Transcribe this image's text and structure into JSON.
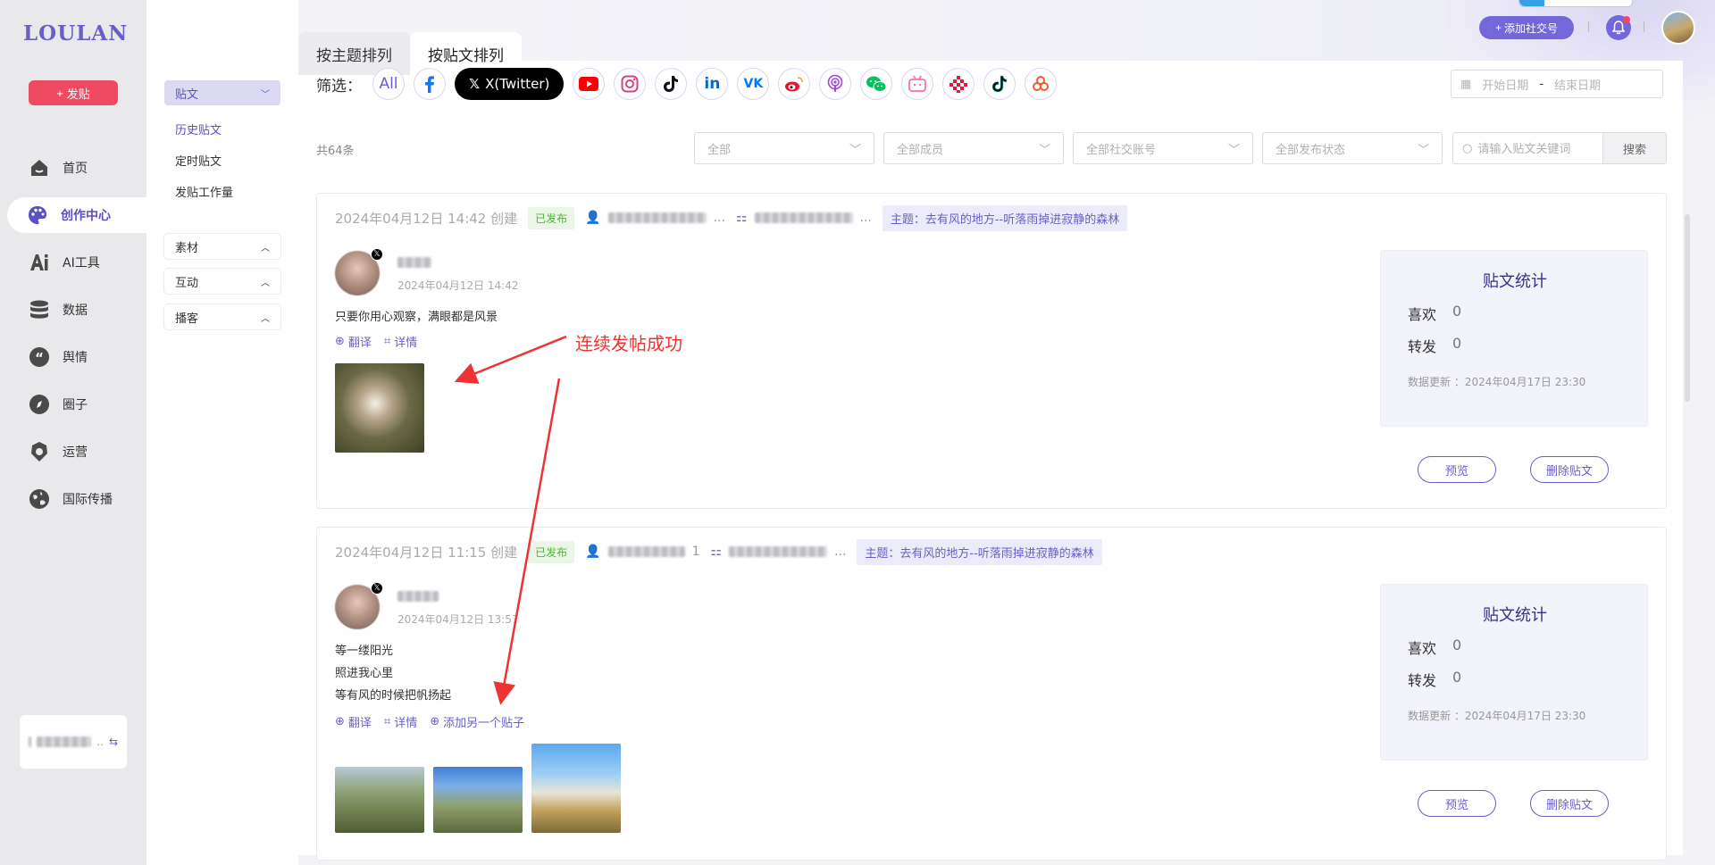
{
  "app": {
    "logo": "LOULAN",
    "post_button": "发贴",
    "nav": [
      {
        "label": "首页",
        "icon": "home-icon"
      },
      {
        "label": "创作中心",
        "icon": "palette-icon",
        "active": true
      },
      {
        "label": "AI工具",
        "icon": "ai-icon"
      },
      {
        "label": "数据",
        "icon": "database-icon"
      },
      {
        "label": "舆情",
        "icon": "quote-icon"
      },
      {
        "label": "圈子",
        "icon": "compass-icon"
      },
      {
        "label": "运营",
        "icon": "operations-icon"
      },
      {
        "label": "国际传播",
        "icon": "globe-icon"
      }
    ]
  },
  "subnav": {
    "group_posts": "贴文",
    "links": [
      "历史贴文",
      "定时贴文",
      "发贴工作量"
    ],
    "group_material": "素材",
    "group_interact": "互动",
    "group_podcast": "播客"
  },
  "header": {
    "add_account": "添加社交号"
  },
  "tabs": [
    "按主题排列",
    "按贴文排列"
  ],
  "filter": {
    "label": "筛选：",
    "all": "All",
    "x_label": "X(Twitter)",
    "platforms": [
      "facebook-icon",
      "youtube-icon",
      "instagram-icon",
      "tiktok-icon",
      "linkedin-icon",
      "vk-icon",
      "weibo-icon",
      "podcast-icon",
      "wechat-icon",
      "bilibili-icon",
      "kuaishou-icon",
      "douyin-icon",
      "xiaohongshu-icon"
    ],
    "date_start": "开始日期",
    "date_sep": "-",
    "date_end": "结束日期"
  },
  "list": {
    "count": "共64条",
    "select_all": "全部",
    "select_members": "全部成员",
    "select_accounts": "全部社交账号",
    "select_status": "全部发布状态",
    "search_placeholder": "请输入贴文关键词",
    "search_button": "搜索"
  },
  "posts": [
    {
      "created": "2024年04月12日 14:42 创建",
      "status": "已发布",
      "member_suffix": "...",
      "account_suffix": "...",
      "topic": "主题：去有风的地方--听落雨掉进寂静的森林",
      "time": "2024年04月12日 14:42",
      "lines": [
        "只要你用心观察，满眼都是风景"
      ],
      "actions": [
        "翻译",
        "详情"
      ],
      "stats_title": "贴文统计",
      "likes_label": "喜欢",
      "likes": "0",
      "shares_label": "转发",
      "shares": "0",
      "updated": "数据更新 ：2024年04月17日 23:30",
      "preview": "预览",
      "delete": "删除贴文"
    },
    {
      "created": "2024年04月12日 11:15 创建",
      "status": "已发布",
      "member_suffix": "1",
      "account_suffix": "...",
      "topic": "主题：去有风的地方--听落雨掉进寂静的森林",
      "time": "2024年04月12日 13:57",
      "lines": [
        "等一缕阳光",
        "照进我心里",
        "等有风的时候把帆扬起"
      ],
      "actions": [
        "翻译",
        "详情",
        "添加另一个贴子"
      ],
      "stats_title": "贴文统计",
      "likes_label": "喜欢",
      "likes": "0",
      "shares_label": "转发",
      "shares": "0",
      "updated": "数据更新 ：2024年04月17日 23:30",
      "preview": "预览",
      "delete": "删除贴文"
    }
  ],
  "annotation": "连续发帖成功",
  "colors": {
    "accent": "#6a5fc9",
    "post_red": "#ee4b62",
    "annotation_red": "#ee3333",
    "published_green": "#52b43a"
  }
}
